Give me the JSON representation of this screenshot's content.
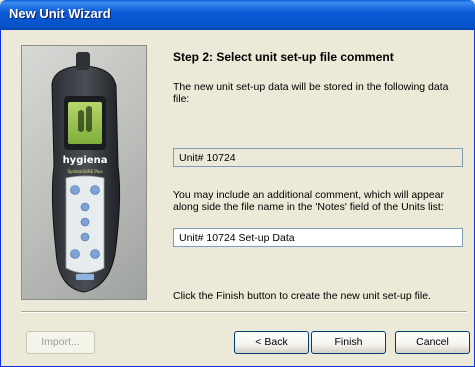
{
  "window": {
    "title": "New Unit Wizard"
  },
  "device_image": {
    "brand": "hygiena",
    "model": "SystemSURE Plus"
  },
  "step": {
    "title": "Step 2: Select unit set-up file comment",
    "data_file_description": "The new unit set-up data will be stored in the following data file:",
    "data_file_value": "Unit# 10724",
    "comment_description": "You may include an additional comment, which will appear along side the file name in the 'Notes' field of the Units list:",
    "comment_value": "Unit# 10724 Set-up Data",
    "finish_hint": "Click the Finish button to create the new unit set-up file."
  },
  "buttons": {
    "import": "Import...",
    "back": "< Back",
    "finish": "Finish",
    "cancel": "Cancel"
  }
}
